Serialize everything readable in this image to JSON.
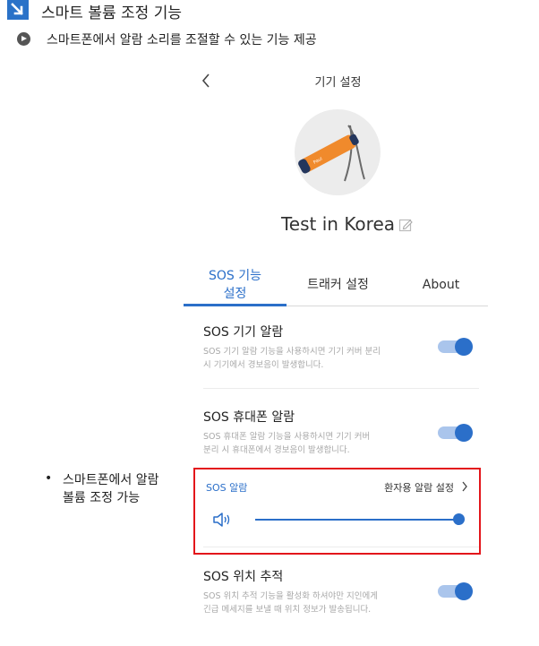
{
  "header": {
    "title": "스마트 볼륨 조정 기능",
    "icon": "arrow-down-right-icon",
    "color": "#2a72c8"
  },
  "subtitle": {
    "text": "스마트폰에서 알람 소리를 조절할 수 있는 기능 제공",
    "icon": "play-circle-icon"
  },
  "side_note": {
    "bullet": "•",
    "lines": [
      "스마트폰에서 알람",
      "볼륨 조정 가능"
    ]
  },
  "screen": {
    "title": "기기 설정",
    "back_icon": "chevron-left-icon",
    "device_name": "Test in Korea",
    "edit_icon": "edit-icon",
    "tabs": [
      {
        "label_line1": "SOS 기능",
        "label_line2": "설정",
        "active": true
      },
      {
        "label": "트래커 설정",
        "active": false
      },
      {
        "label": "About",
        "active": false
      }
    ],
    "settings": [
      {
        "title": "SOS 기기 알람",
        "desc_line1": "SOS 기기 알람 기능을 사용하시면 기기 커버 분리",
        "desc_line2": "시 기기에서 경보음이 발생합니다.",
        "enabled": true
      },
      {
        "title": "SOS 휴대폰 알람",
        "desc_line1": "SOS 휴대폰 알람 기능을 사용하시면 기기 커버",
        "desc_line2": "분리 시 휴대폰에서 경보음이 발생합니다.",
        "enabled": true
      },
      {
        "title": "SOS 위치 추적",
        "desc_line1": "SOS 위치 추적 기능을 활성화 하셔야만 지인에게",
        "desc_line2": "긴급 메세지를 보낼 때 위치 정보가 발송됩니다.",
        "enabled": true
      }
    ],
    "alarm": {
      "label": "SOS 알람",
      "link": "환자용 알람 설정",
      "volume": 1.0,
      "speaker_icon": "speaker-icon"
    },
    "accent": "#2b6fc9",
    "highlight": "#e3161b"
  }
}
